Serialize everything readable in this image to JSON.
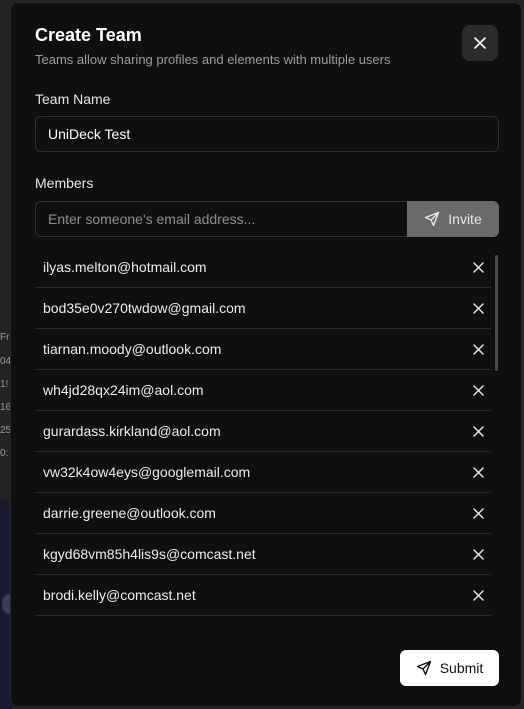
{
  "background": {
    "fragments": [
      "Fr",
      "04",
      "1!",
      "16",
      "25",
      "0:"
    ]
  },
  "modal": {
    "title": "Create Team",
    "subtitle": "Teams allow sharing profiles and elements with multiple users",
    "close_icon": "close-icon",
    "team_name_label": "Team Name",
    "team_name_value": "UniDeck Test",
    "members_label": "Members",
    "email_placeholder": "Enter someone's email address...",
    "invite_label": "Invite",
    "invite_icon": "send-icon",
    "members": [
      "ilyas.melton@hotmail.com",
      "bod35e0v270twdow@gmail.com",
      "tiarnan.moody@outlook.com",
      "wh4jd28qx24im@aol.com",
      "gurardass.kirkland@aol.com",
      "vw32k4ow4eys@googlemail.com",
      "darrie.greene@outlook.com",
      "kgyd68vm85h4lis9s@comcast.net",
      "brodi.kelly@comcast.net"
    ],
    "submit_label": "Submit",
    "submit_icon": "send-icon"
  },
  "colors": {
    "modal_bg": "#0f0f0f",
    "invite_bg": "#6a6a6a",
    "submit_bg": "#ffffff"
  }
}
